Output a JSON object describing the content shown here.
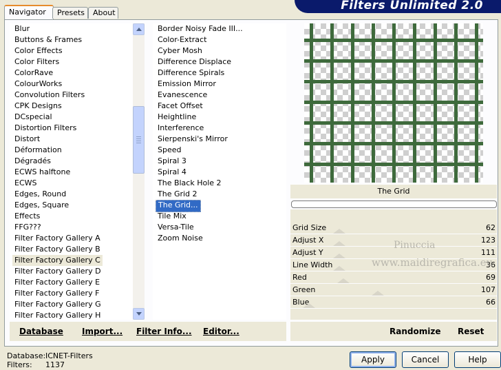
{
  "tabs": [
    {
      "label": "Navigator",
      "active": true
    },
    {
      "label": "Presets",
      "active": false
    },
    {
      "label": "About",
      "active": false
    }
  ],
  "banner_title": "Filters Unlimited 2.0",
  "categories": [
    "Blur",
    "Buttons & Frames",
    "Color Effects",
    "Color Filters",
    "ColorRave",
    "ColourWorks",
    "Convolution Filters",
    "CPK Designs",
    "DCspecial",
    "Distortion Filters",
    "Distort",
    "Déformation",
    "Dégradés",
    "ECWS halftone",
    "ECWS",
    "Edges, Round",
    "Edges, Square",
    "Effects",
    "FFG???",
    "Filter Factory Gallery A",
    "Filter Factory Gallery B",
    "Filter Factory Gallery C",
    "Filter Factory Gallery D",
    "Filter Factory Gallery E",
    "Filter Factory Gallery F",
    "Filter Factory Gallery G",
    "Filter Factory Gallery H"
  ],
  "selected_category": "Filter Factory Gallery C",
  "filters": [
    "Border Noisy Fade III...",
    "Color-Extract",
    "Cyber Mosh",
    "Difference Displace",
    "Difference Spirals",
    "Emission Mirror",
    "Evanescence",
    "Facet Offset",
    "Heightline",
    "Interference",
    "Sierpenski's Mirror",
    "Speed",
    "Spiral 3",
    "Spiral 4",
    "The Black Hole 2",
    "The Grid 2",
    "The Grid...",
    "Tile Mix",
    "Versa-Tile",
    "Zoom Noise"
  ],
  "selected_filter": "The Grid...",
  "preview": {
    "filter_name": "The Grid",
    "grid_color": "#3e6a3c"
  },
  "params": [
    {
      "label": "Grid Size",
      "value": "62"
    },
    {
      "label": "Adjust X",
      "value": "123"
    },
    {
      "label": "Adjust Y",
      "value": "111"
    },
    {
      "label": "Line Width",
      "value": "36"
    },
    {
      "label": "Red",
      "value": "69"
    },
    {
      "label": "Green",
      "value": "107"
    },
    {
      "label": "Blue",
      "value": "66"
    }
  ],
  "watermark": {
    "line1": "Pinuccia",
    "line2": "www.maidiregrafica.eu"
  },
  "left_buttons": [
    "Database",
    "Import...",
    "Filter Info...",
    "Editor..."
  ],
  "right_buttons": [
    "Randomize",
    "Reset"
  ],
  "status": {
    "database_label": "Database:",
    "database_value": "ICNET-Filters",
    "filters_label": "Filters:",
    "filters_value": "1137"
  },
  "dialog_buttons": {
    "apply": "Apply",
    "cancel": "Cancel",
    "help": "Help"
  }
}
